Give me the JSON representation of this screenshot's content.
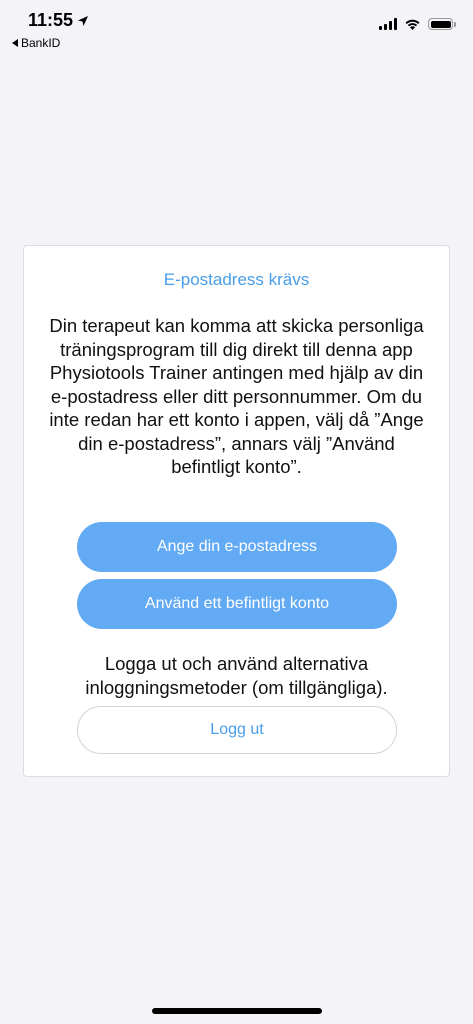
{
  "status_bar": {
    "time": "11:55",
    "back_app": "BankID"
  },
  "card": {
    "title": "E-postadress krävs",
    "body": "Din terapeut kan komma att skicka personliga träningsprogram till dig direkt till denna app Physiotools Trainer antingen med hjälp av din e-postadress eller ditt personnummer. Om du inte redan har ett konto i appen, välj då ”Ange din e-postadress”, annars välj ”Använd befintligt konto”.",
    "email_button": "Ange din e-postadress",
    "existing_button": "Använd ett befintligt konto",
    "logout_text": "Logga ut och använd alternativa inloggningsmetoder (om tillgängliga).",
    "logout_button": "Logg ut"
  },
  "colors": {
    "accent": "#4a9de8",
    "button_bg": "#62aaf4",
    "background": "#f3f3f8"
  }
}
